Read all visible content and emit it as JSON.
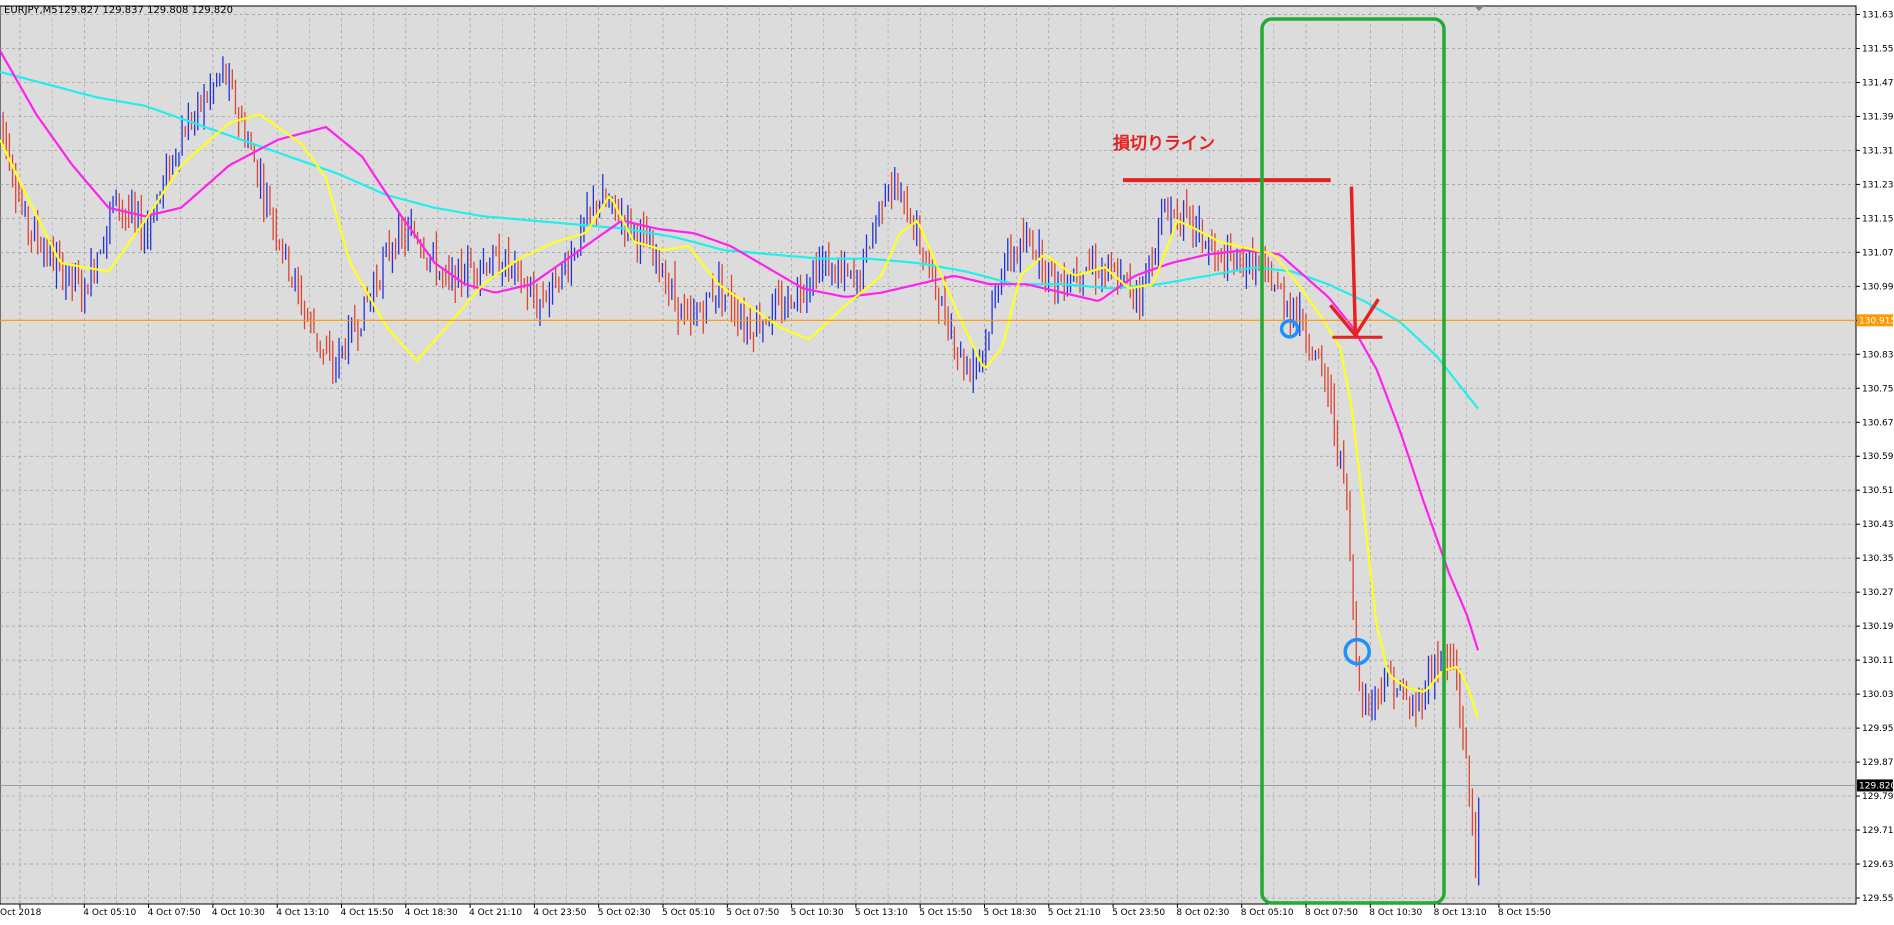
{
  "header": {
    "symbol": "EURJPY,M5",
    "ohlc": "129.827 129.837 129.808 129.820"
  },
  "annotation": {
    "stop_loss_label": "損切りライン"
  },
  "chart_data": {
    "type": "line",
    "colors": {
      "background": "#dcdcdc",
      "grid": "#9a9a9a",
      "bullish": "#2233dd",
      "bearish": "#dd4433",
      "ma_fast": "#ffff22",
      "ma_mid": "#ff22ee",
      "ma_slow": "#22eeee",
      "level": "#ff9900",
      "annotation": "#e52222",
      "box": "#22aa33",
      "circle": "#1e90ff"
    },
    "ylim": [
      129.555,
      131.655
    ],
    "y_ticks": [
      "131.635",
      "131.555",
      "131.475",
      "131.395",
      "131.315",
      "131.235",
      "131.155",
      "131.075",
      "130.995",
      "130.915",
      "130.835",
      "130.755",
      "130.675",
      "130.595",
      "130.515",
      "130.435",
      "130.355",
      "130.275",
      "130.195",
      "130.115",
      "130.035",
      "129.955",
      "129.875",
      "129.795",
      "129.715",
      "129.635",
      "129.555"
    ],
    "y_tick_values": [
      131.635,
      131.555,
      131.475,
      131.395,
      131.315,
      131.235,
      131.155,
      131.075,
      130.995,
      130.915,
      130.835,
      130.755,
      130.675,
      130.595,
      130.515,
      130.435,
      130.355,
      130.275,
      130.195,
      130.115,
      130.035,
      129.955,
      129.875,
      129.795,
      129.715,
      129.635,
      129.555
    ],
    "x_ticks": [
      "Oct 2018",
      "4 Oct 05:10",
      "4 Oct 07:50",
      "4 Oct 10:30",
      "4 Oct 13:10",
      "4 Oct 15:50",
      "4 Oct 18:30",
      "4 Oct 21:10",
      "4 Oct 23:50",
      "5 Oct 02:30",
      "5 Oct 05:10",
      "5 Oct 07:50",
      "5 Oct 10:30",
      "5 Oct 13:10",
      "5 Oct 15:50",
      "5 Oct 18:30",
      "5 Oct 21:10",
      "5 Oct 23:50",
      "8 Oct 02:30",
      "8 Oct 05:10",
      "8 Oct 07:50",
      "8 Oct 10:30",
      "8 Oct 13:10",
      "8 Oct 15:50"
    ],
    "n_bars": 470,
    "price_path": [
      [
        0,
        131.4
      ],
      [
        20,
        131.15
      ],
      [
        45,
        131.05
      ],
      [
        70,
        130.98
      ],
      [
        95,
        131.2
      ],
      [
        120,
        131.12
      ],
      [
        150,
        131.35
      ],
      [
        185,
        131.5
      ],
      [
        200,
        131.38
      ],
      [
        215,
        131.25
      ],
      [
        250,
        130.95
      ],
      [
        275,
        130.8
      ],
      [
        300,
        130.93
      ],
      [
        325,
        131.1
      ],
      [
        345,
        131.12
      ],
      [
        370,
        131.0
      ],
      [
        395,
        131.05
      ],
      [
        420,
        131.05
      ],
      [
        445,
        130.95
      ],
      [
        470,
        131.05
      ],
      [
        495,
        131.2
      ],
      [
        520,
        131.15
      ],
      [
        545,
        131.05
      ],
      [
        570,
        130.9
      ],
      [
        595,
        131.0
      ],
      [
        620,
        130.9
      ],
      [
        650,
        130.95
      ],
      [
        680,
        131.05
      ],
      [
        710,
        131.0
      ],
      [
        735,
        131.25
      ],
      [
        755,
        131.15
      ],
      [
        780,
        130.95
      ],
      [
        800,
        130.8
      ],
      [
        815,
        130.85
      ],
      [
        830,
        131.05
      ],
      [
        855,
        131.1
      ],
      [
        875,
        131.0
      ],
      [
        900,
        131.05
      ],
      [
        920,
        131.02
      ],
      [
        945,
        130.98
      ],
      [
        965,
        131.18
      ],
      [
        985,
        131.15
      ],
      [
        1010,
        131.05
      ],
      [
        1040,
        131.05
      ],
      [
        1060,
        130.98
      ],
      [
        1080,
        130.9
      ],
      [
        1100,
        130.75
      ],
      [
        1115,
        130.5
      ],
      [
        1122,
        130.15
      ],
      [
        1130,
        130.0
      ],
      [
        1150,
        130.08
      ],
      [
        1170,
        129.99
      ],
      [
        1190,
        130.12
      ],
      [
        1205,
        130.1
      ],
      [
        1215,
        129.85
      ],
      [
        1222,
        129.65
      ],
      [
        1226,
        129.82
      ]
    ],
    "ma_fast": [
      [
        0,
        131.34
      ],
      [
        20,
        131.22
      ],
      [
        50,
        131.05
      ],
      [
        90,
        131.03
      ],
      [
        120,
        131.15
      ],
      [
        150,
        131.28
      ],
      [
        190,
        131.38
      ],
      [
        215,
        131.4
      ],
      [
        250,
        131.33
      ],
      [
        270,
        131.25
      ],
      [
        290,
        131.05
      ],
      [
        320,
        130.9
      ],
      [
        345,
        130.82
      ],
      [
        370,
        130.9
      ],
      [
        400,
        131.0
      ],
      [
        430,
        131.06
      ],
      [
        460,
        131.1
      ],
      [
        485,
        131.12
      ],
      [
        505,
        131.21
      ],
      [
        525,
        131.1
      ],
      [
        550,
        131.08
      ],
      [
        570,
        131.09
      ],
      [
        595,
        131.0
      ],
      [
        620,
        130.95
      ],
      [
        645,
        130.9
      ],
      [
        670,
        130.87
      ],
      [
        700,
        130.95
      ],
      [
        730,
        131.02
      ],
      [
        745,
        131.12
      ],
      [
        760,
        131.15
      ],
      [
        775,
        131.05
      ],
      [
        795,
        130.92
      ],
      [
        815,
        130.8
      ],
      [
        830,
        130.85
      ],
      [
        845,
        131.02
      ],
      [
        865,
        131.07
      ],
      [
        890,
        131.02
      ],
      [
        915,
        131.04
      ],
      [
        935,
        130.99
      ],
      [
        955,
        131.0
      ],
      [
        975,
        131.15
      ],
      [
        990,
        131.13
      ],
      [
        1010,
        131.1
      ],
      [
        1040,
        131.08
      ],
      [
        1055,
        131.07
      ],
      [
        1075,
        131.0
      ],
      [
        1095,
        130.92
      ],
      [
        1110,
        130.85
      ],
      [
        1120,
        130.7
      ],
      [
        1130,
        130.45
      ],
      [
        1140,
        130.2
      ],
      [
        1150,
        130.08
      ],
      [
        1165,
        130.05
      ],
      [
        1180,
        130.04
      ],
      [
        1195,
        130.09
      ],
      [
        1207,
        130.1
      ],
      [
        1216,
        130.05
      ],
      [
        1226,
        129.96
      ]
    ],
    "ma_mid": [
      [
        0,
        131.55
      ],
      [
        30,
        131.4
      ],
      [
        60,
        131.28
      ],
      [
        90,
        131.18
      ],
      [
        120,
        131.16
      ],
      [
        150,
        131.18
      ],
      [
        190,
        131.28
      ],
      [
        230,
        131.34
      ],
      [
        270,
        131.37
      ],
      [
        300,
        131.3
      ],
      [
        330,
        131.17
      ],
      [
        360,
        131.05
      ],
      [
        385,
        131.0
      ],
      [
        410,
        130.98
      ],
      [
        440,
        131.0
      ],
      [
        465,
        131.05
      ],
      [
        490,
        131.1
      ],
      [
        515,
        131.15
      ],
      [
        545,
        131.13
      ],
      [
        575,
        131.12
      ],
      [
        605,
        131.09
      ],
      [
        635,
        131.04
      ],
      [
        665,
        130.99
      ],
      [
        700,
        130.97
      ],
      [
        730,
        130.98
      ],
      [
        760,
        131.0
      ],
      [
        790,
        131.02
      ],
      [
        820,
        131.0
      ],
      [
        850,
        131.0
      ],
      [
        880,
        130.98
      ],
      [
        910,
        130.96
      ],
      [
        940,
        131.02
      ],
      [
        970,
        131.05
      ],
      [
        1000,
        131.07
      ],
      [
        1030,
        131.08
      ],
      [
        1060,
        131.07
      ],
      [
        1080,
        131.02
      ],
      [
        1100,
        130.97
      ],
      [
        1120,
        130.9
      ],
      [
        1140,
        130.8
      ],
      [
        1160,
        130.65
      ],
      [
        1180,
        130.48
      ],
      [
        1200,
        130.32
      ],
      [
        1215,
        130.22
      ],
      [
        1226,
        130.12
      ]
    ],
    "ma_slow": [
      [
        0,
        131.5
      ],
      [
        40,
        131.47
      ],
      [
        80,
        131.44
      ],
      [
        120,
        131.42
      ],
      [
        160,
        131.38
      ],
      [
        200,
        131.34
      ],
      [
        240,
        131.3
      ],
      [
        280,
        131.26
      ],
      [
        320,
        131.21
      ],
      [
        360,
        131.18
      ],
      [
        400,
        131.16
      ],
      [
        440,
        131.15
      ],
      [
        480,
        131.14
      ],
      [
        520,
        131.13
      ],
      [
        560,
        131.11
      ],
      [
        600,
        131.08
      ],
      [
        640,
        131.07
      ],
      [
        680,
        131.06
      ],
      [
        720,
        131.06
      ],
      [
        760,
        131.05
      ],
      [
        800,
        131.03
      ],
      [
        840,
        131.0
      ],
      [
        880,
        131.0
      ],
      [
        920,
        130.99
      ],
      [
        960,
        131.0
      ],
      [
        1000,
        131.02
      ],
      [
        1040,
        131.04
      ],
      [
        1070,
        131.03
      ],
      [
        1100,
        131.0
      ],
      [
        1130,
        130.96
      ],
      [
        1160,
        130.91
      ],
      [
        1190,
        130.83
      ],
      [
        1226,
        130.7
      ]
    ],
    "horizontal_line_level": 130.915,
    "right_tags": [
      "130.915",
      "129.820"
    ],
    "annotations": {
      "stop_line": {
        "x_range_idx": [
          930,
          1073
        ],
        "price": 131.245
      },
      "arrow": {
        "idx": 1120,
        "from_price": 131.23,
        "to_price": 130.88
      },
      "box_idx": [
        1045,
        1195
      ],
      "circles": [
        {
          "idx": 1068,
          "price": 130.895
        },
        {
          "idx": 1124,
          "price": 130.135
        }
      ]
    }
  }
}
